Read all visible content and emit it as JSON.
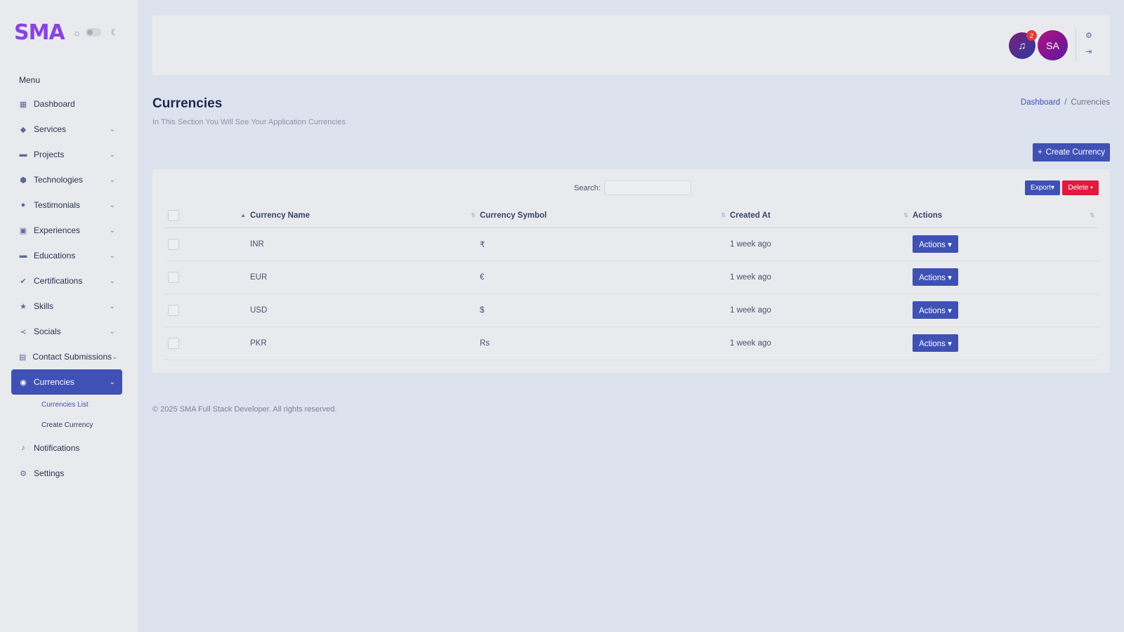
{
  "sidebar": {
    "logo": "SMA",
    "menu_title": "Menu",
    "items": [
      {
        "label": "Dashboard",
        "icon": "grid-icon"
      },
      {
        "label": "Services",
        "icon": "tag-icon"
      },
      {
        "label": "Projects",
        "icon": "folder-icon"
      },
      {
        "label": "Technologies",
        "icon": "cube-icon"
      },
      {
        "label": "Testimonials",
        "icon": "chat-icon"
      },
      {
        "label": "Experiences",
        "icon": "badge-icon"
      },
      {
        "label": "Educations",
        "icon": "book-icon"
      },
      {
        "label": "Certifications",
        "icon": "certificate-icon"
      },
      {
        "label": "Skills",
        "icon": "star-icon"
      },
      {
        "label": "Socials",
        "icon": "share-icon"
      },
      {
        "label": "Contact Submissions",
        "icon": "inbox-icon"
      },
      {
        "label": "Currencies",
        "icon": "coins-icon"
      },
      {
        "label": "Notifications",
        "icon": "bell-icon"
      },
      {
        "label": "Settings",
        "icon": "gear-icon"
      }
    ],
    "sub_items": [
      "Currencies List",
      "Create Currency"
    ]
  },
  "topbar": {
    "notification_count": "2",
    "avatar_initials": "SA"
  },
  "page": {
    "title": "Currencies",
    "subtitle": "In This Section You Will See Your Application Currencies",
    "breadcrumb": [
      "Dashboard",
      "/",
      "Currencies"
    ],
    "create_button": "Create Currency"
  },
  "table": {
    "search_label": "Search:",
    "export_label": "Export",
    "delete_label": "Delete",
    "columns": [
      "Currency Name",
      "Currency Symbol",
      "Created At",
      "Actions"
    ],
    "rows": [
      {
        "name": "INR",
        "symbol": "₹",
        "created": "1 week ago",
        "action": "Actions"
      },
      {
        "name": "EUR",
        "symbol": "€",
        "created": "1 week ago",
        "action": "Actions"
      },
      {
        "name": "USD",
        "symbol": "$",
        "created": "1 week ago",
        "action": "Actions"
      },
      {
        "name": "PKR",
        "symbol": "Rs",
        "created": "1 week ago",
        "action": "Actions"
      }
    ]
  },
  "footer": "© 2025 SMA Full Stack Developer. All rights reserved.",
  "colors": {
    "primary": "#3f51b5",
    "danger": "#e0193f",
    "logo": "#8a43e0",
    "background": "#dde3ee"
  }
}
